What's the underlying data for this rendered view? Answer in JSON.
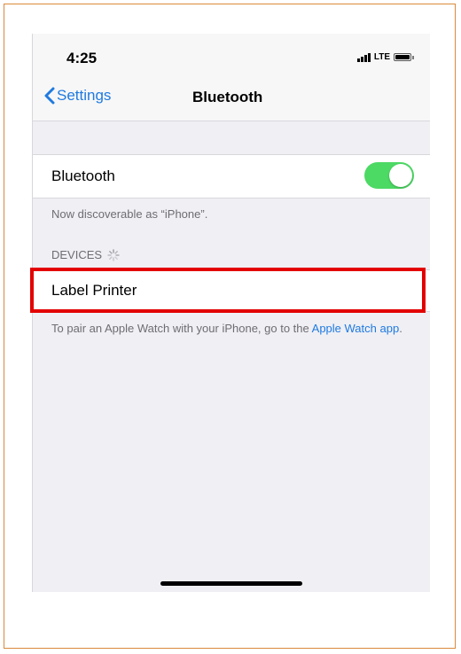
{
  "status_bar": {
    "time": "4:25",
    "network": "LTE"
  },
  "nav": {
    "back_label": "Settings",
    "title": "Bluetooth"
  },
  "bluetooth": {
    "label": "Bluetooth",
    "enabled": true,
    "discoverable_text": "Now discoverable as “iPhone”."
  },
  "devices": {
    "header": "DEVICES",
    "items": [
      {
        "label": "Label Printer"
      }
    ]
  },
  "footnote": {
    "text": "To pair an Apple Watch with your iPhone, go to the ",
    "link_text": "Apple Watch app",
    "end": "."
  },
  "colors": {
    "accent": "#1f7ae0",
    "toggle_on": "#4cd964",
    "highlight": "#e30000"
  }
}
